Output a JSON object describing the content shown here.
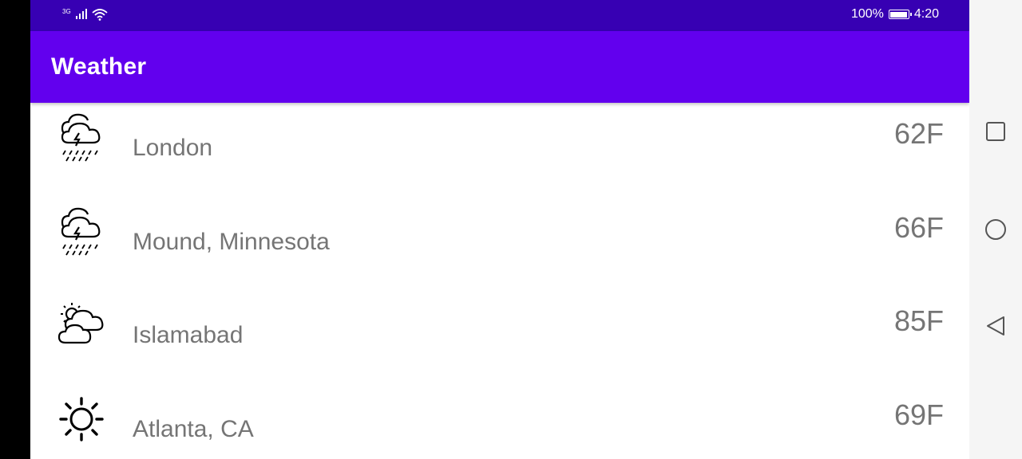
{
  "status_bar": {
    "network_type": "3G",
    "battery_percent": "100%",
    "time": "4:20",
    "icons": [
      "signal-icon",
      "wifi-icon",
      "battery-icon"
    ]
  },
  "app_bar": {
    "title": "Weather"
  },
  "locations": [
    {
      "city": "London",
      "temp": "62F",
      "icon": "thunderstorm-icon"
    },
    {
      "city": "Mound, Minnesota",
      "temp": "66F",
      "icon": "thunderstorm-icon"
    },
    {
      "city": "Islamabad",
      "temp": "85F",
      "icon": "partly-cloudy-icon"
    },
    {
      "city": "Atlanta, CA",
      "temp": "69F",
      "icon": "sunny-icon"
    }
  ],
  "nav_bar": {
    "buttons": [
      "recents-button",
      "home-button",
      "back-button"
    ]
  },
  "colors": {
    "status_bar": "#3700b3",
    "app_bar": "#6200ee",
    "text_secondary": "#757575",
    "nav_bar": "#f5f5f5"
  }
}
